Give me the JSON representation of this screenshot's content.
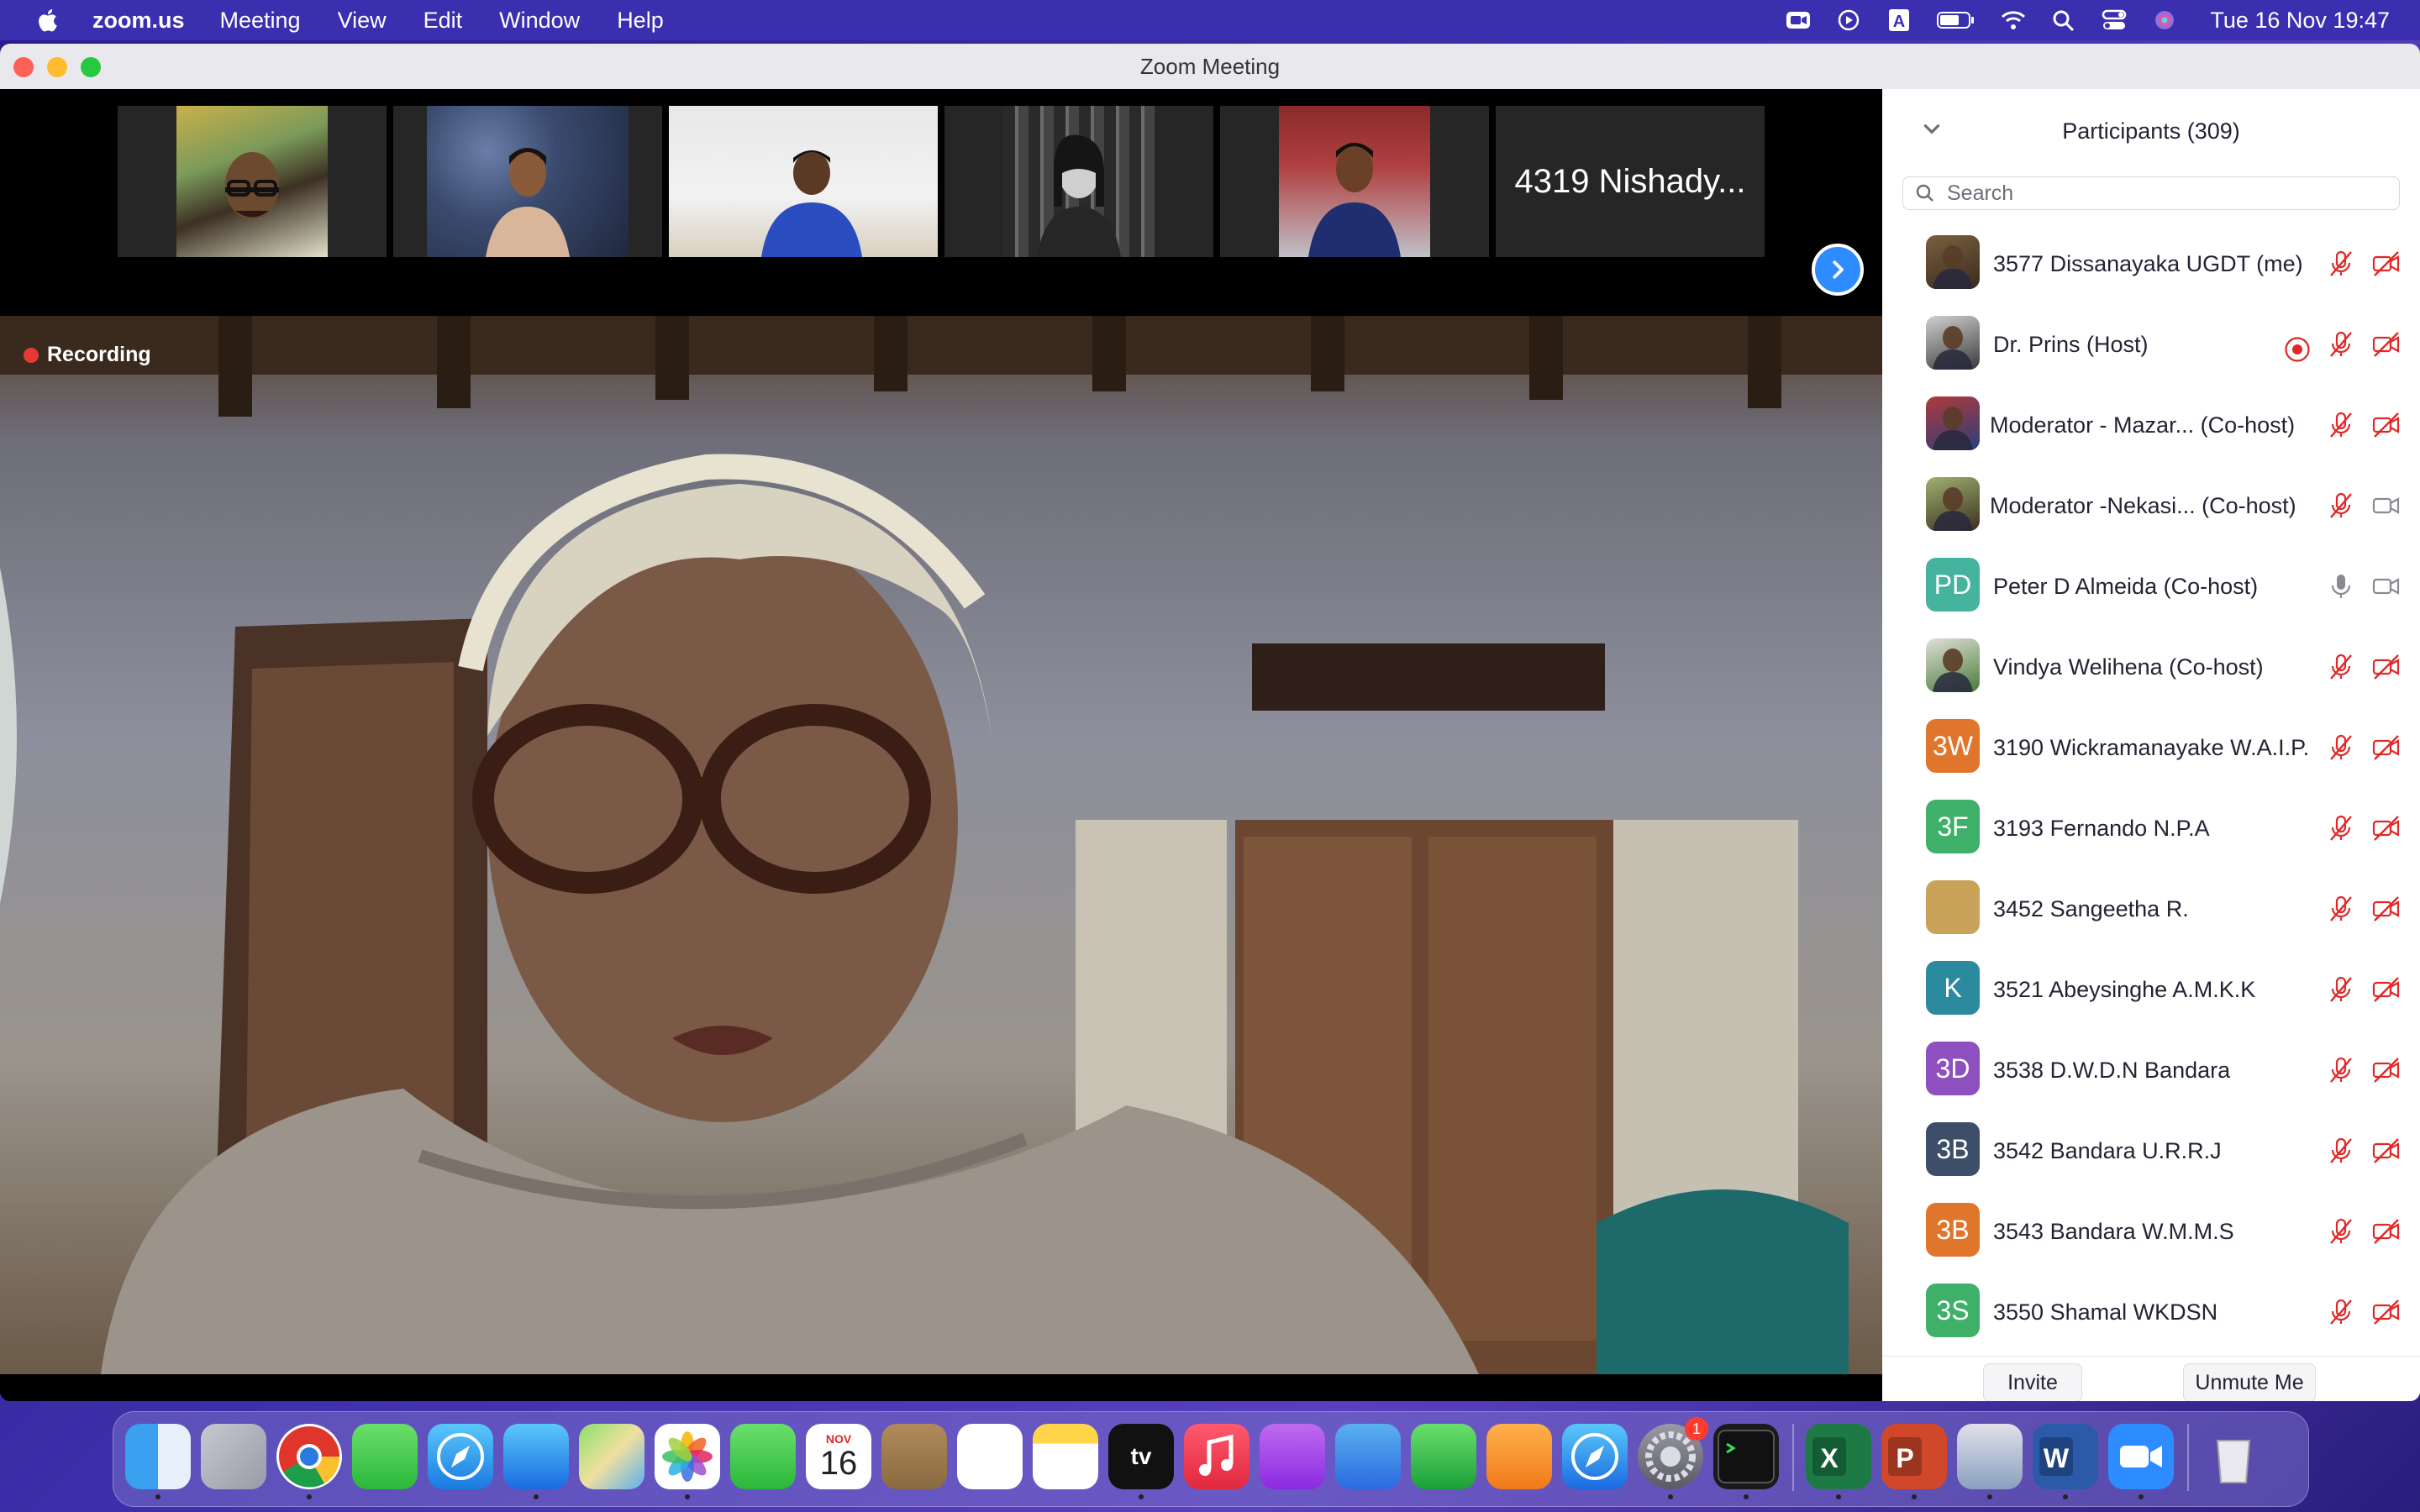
{
  "menubar": {
    "app_name": "zoom.us",
    "menus": [
      "Meeting",
      "View",
      "Edit",
      "Window",
      "Help"
    ],
    "clock": "Tue 16 Nov  19:47",
    "status_icons": [
      "zoom-status-icon",
      "screen-record-icon",
      "input-source-icon",
      "battery-icon",
      "wifi-icon",
      "spotlight-icon",
      "control-center-icon",
      "siri-icon"
    ],
    "input_source_letter": "A",
    "bar_color": "#3a2fae"
  },
  "window": {
    "title": "Zoom Meeting"
  },
  "thumbnails": {
    "name_tile": "4319 Nishady...",
    "next_icon": "chevron-right-icon"
  },
  "main_video": {
    "recording_label": "Recording"
  },
  "participants": {
    "header": "Participants (309)",
    "search_placeholder": "Search",
    "list": [
      {
        "name": "3577 Dissanayaka UGDT (me)",
        "avatar": "photo",
        "mic": "muted",
        "cam": "off"
      },
      {
        "name": "Dr. Prins (Host)",
        "avatar": "photo",
        "mic": "muted",
        "cam": "off",
        "recording": true
      },
      {
        "name": "Moderator - Mazar...  (Co-host)",
        "avatar": "photo",
        "mic": "muted",
        "cam": "off"
      },
      {
        "name": "Moderator -Nekasi...  (Co-host)",
        "avatar": "photo",
        "mic": "muted",
        "cam": "on"
      },
      {
        "name": "Peter D Almeida (Co-host)",
        "avatar": "PD",
        "avatar_color": "#45b39d",
        "mic": "on",
        "cam": "on"
      },
      {
        "name": "Vindya Welihena (Co-host)",
        "avatar": "photo",
        "mic": "muted",
        "cam": "off"
      },
      {
        "name": "3190 Wickramanayake W.A.I.P.",
        "avatar": "3W",
        "avatar_color": "#e0762b",
        "mic": "muted",
        "cam": "off"
      },
      {
        "name": "3193 Fernando N.P.A",
        "avatar": "3F",
        "avatar_color": "#3fb06a",
        "mic": "muted",
        "cam": "off"
      },
      {
        "name": "3452 Sangeetha R.",
        "avatar": "",
        "avatar_color": "#c9a35a",
        "mic": "muted",
        "cam": "off"
      },
      {
        "name": "3521 Abeysinghe A.M.K.K",
        "avatar": "K",
        "avatar_color": "#2b8a9e",
        "mic": "muted",
        "cam": "off"
      },
      {
        "name": "3538 D.W.D.N Bandara",
        "avatar": "3D",
        "avatar_color": "#8e4fbf",
        "mic": "muted",
        "cam": "off"
      },
      {
        "name": "3542 Bandara U.R.R.J",
        "avatar": "3B",
        "avatar_color": "#3d4f68",
        "mic": "muted",
        "cam": "off"
      },
      {
        "name": "3543 Bandara W.M.M.S",
        "avatar": "3B",
        "avatar_color": "#e0762b",
        "mic": "muted",
        "cam": "off"
      },
      {
        "name": "3550 Shamal WKDSN",
        "avatar": "3S",
        "avatar_color": "#3fb06a",
        "mic": "muted",
        "cam": "off"
      }
    ],
    "invite_label": "Invite",
    "unmute_label": "Unmute Me"
  },
  "dock": {
    "apps": [
      "finder-icon",
      "launchpad-icon",
      "chrome-icon",
      "messages-icon",
      "safari-icon",
      "mail-icon",
      "maps-icon",
      "photos-icon",
      "facetime-icon",
      "calendar-icon",
      "contacts-icon",
      "reminders-icon",
      "notes-icon",
      "apple-tv-icon",
      "music-icon",
      "podcasts-icon",
      "keynote-icon",
      "numbers-icon",
      "pages-icon",
      "app-store-icon",
      "system-preferences-icon",
      "terminal-icon",
      "excel-icon",
      "powerpoint-icon",
      "preview-icon",
      "word-icon",
      "zoom-icon",
      "trash-icon"
    ],
    "calendar_month": "NOV",
    "calendar_day": "16",
    "settings_badge": "1",
    "tv_label": "tv"
  }
}
